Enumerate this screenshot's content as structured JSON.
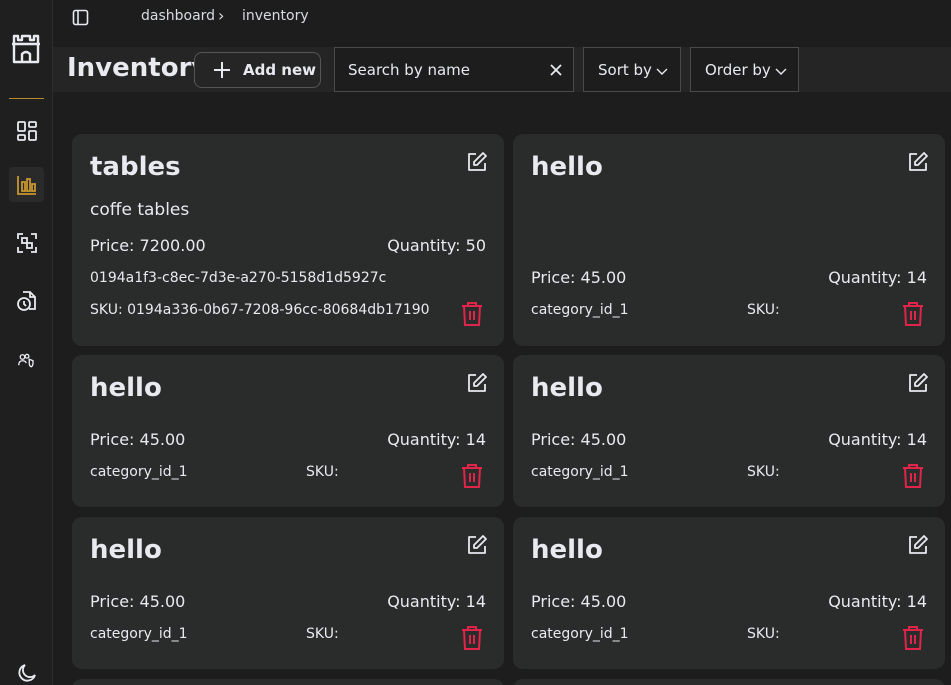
{
  "breadcrumb": [
    "dashboard",
    "inventory"
  ],
  "page_title": "Inventory",
  "add_button_label": "Add new",
  "search": {
    "placeholder": "Search by name",
    "value": ""
  },
  "sort_label": "Sort by",
  "order_label": "Order by",
  "colors": {
    "accent": "#b58a2b",
    "delete": "#e0244a",
    "card_bg": "#2a2b2b"
  },
  "sidebar": {
    "items": [
      {
        "icon": "dashboard-grid-icon"
      },
      {
        "icon": "bar-chart-icon",
        "active": true
      },
      {
        "icon": "scan-icon"
      },
      {
        "icon": "clock-document-icon"
      },
      {
        "icon": "users-shield-icon"
      }
    ],
    "bottom_icon": "moon-icon"
  },
  "cards": [
    {
      "title": "tables",
      "description": "coffe tables",
      "price": "Price: 7200.00",
      "quantity": "Quantity: 50",
      "category": "0194a1f3-c8ec-7d3e-a270-5158d1d5927c",
      "sku": "SKU: 0194a336-0b67-7208-96cc-80684db17190"
    },
    {
      "title": "hello",
      "description": "",
      "price": "Price: 45.00",
      "quantity": "Quantity: 14",
      "category": "category_id_1",
      "sku": "SKU:"
    },
    {
      "title": "hello",
      "description": "",
      "price": "Price: 45.00",
      "quantity": "Quantity: 14",
      "category": "category_id_1",
      "sku": "SKU:"
    },
    {
      "title": "hello",
      "description": "",
      "price": "Price: 45.00",
      "quantity": "Quantity: 14",
      "category": "category_id_1",
      "sku": "SKU:"
    },
    {
      "title": "hello",
      "description": "",
      "price": "Price: 45.00",
      "quantity": "Quantity: 14",
      "category": "category_id_1",
      "sku": "SKU:"
    },
    {
      "title": "hello",
      "description": "",
      "price": "Price: 45.00",
      "quantity": "Quantity: 14",
      "category": "category_id_1",
      "sku": "SKU:"
    }
  ]
}
